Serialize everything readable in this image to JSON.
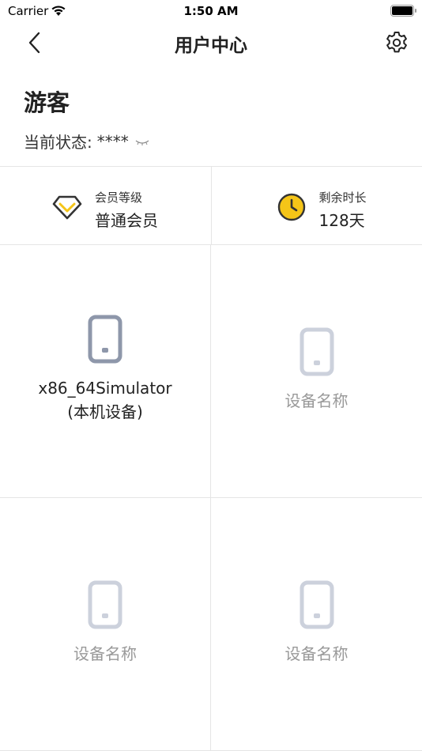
{
  "status_bar": {
    "carrier": "Carrier",
    "time": "1:50 AM"
  },
  "nav": {
    "title": "用户中心"
  },
  "profile": {
    "name": "游客",
    "status_label": "当前状态:",
    "status_value": "****"
  },
  "info": {
    "level_label": "会员等级",
    "level_value": "普通会员",
    "remaining_label": "剩余时长",
    "remaining_value": "128天"
  },
  "devices": [
    {
      "name": "x86_64Simulator",
      "sub": "(本机设备)",
      "active": true
    },
    {
      "name": "设备名称",
      "active": false
    },
    {
      "name": "设备名称",
      "active": false
    },
    {
      "name": "设备名称",
      "active": false
    }
  ],
  "colors": {
    "accent_yellow": "#f5c518",
    "active_phone": "#8e97aa",
    "inactive_phone": "#ccd1dc",
    "divider": "#e5e5e5"
  },
  "icons": {
    "back": "chevron-left-icon",
    "settings": "gear-icon",
    "eye": "closed-eye-icon",
    "level": "diamond-icon",
    "time": "clock-icon",
    "device": "phone-icon"
  }
}
